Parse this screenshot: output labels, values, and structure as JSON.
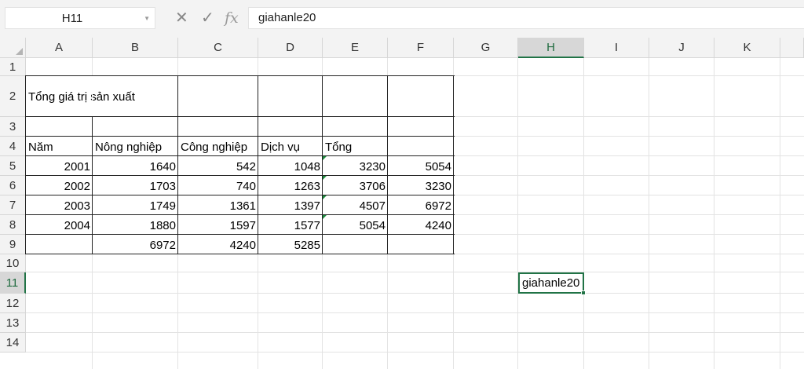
{
  "formula_bar": {
    "name_box": "H11",
    "formula": "giahanle20"
  },
  "columns": [
    "A",
    "B",
    "C",
    "D",
    "E",
    "F",
    "G",
    "H",
    "I",
    "J",
    "K"
  ],
  "rows": [
    "1",
    "2",
    "3",
    "4",
    "5",
    "6",
    "7",
    "8",
    "9",
    "10",
    "11",
    "12",
    "13",
    "14"
  ],
  "sheet": {
    "title": "Tổng giá trị sản xuất",
    "headers": [
      "Năm",
      "Nông nghiệp",
      "Công nghiệp",
      "Dịch vụ",
      "Tổng"
    ],
    "data": [
      [
        "2001",
        "1640",
        "542",
        "1048",
        "3230",
        "5054"
      ],
      [
        "2002",
        "1703",
        "740",
        "1263",
        "3706",
        "3230"
      ],
      [
        "2003",
        "1749",
        "1361",
        "1397",
        "4507",
        "6972"
      ],
      [
        "2004",
        "1880",
        "1597",
        "1577",
        "5054",
        "4240"
      ]
    ],
    "totals": [
      "6972",
      "4240",
      "5285"
    ],
    "h11": "giahanle20"
  },
  "icons": [
    "dropdown-caret-icon",
    "cancel-icon",
    "enter-check-icon",
    "insert-function-icon",
    "select-all-icon"
  ],
  "colors": {
    "accent": "#217346",
    "header_bg": "#f3f3f3",
    "gridline": "#e3e3e3"
  }
}
